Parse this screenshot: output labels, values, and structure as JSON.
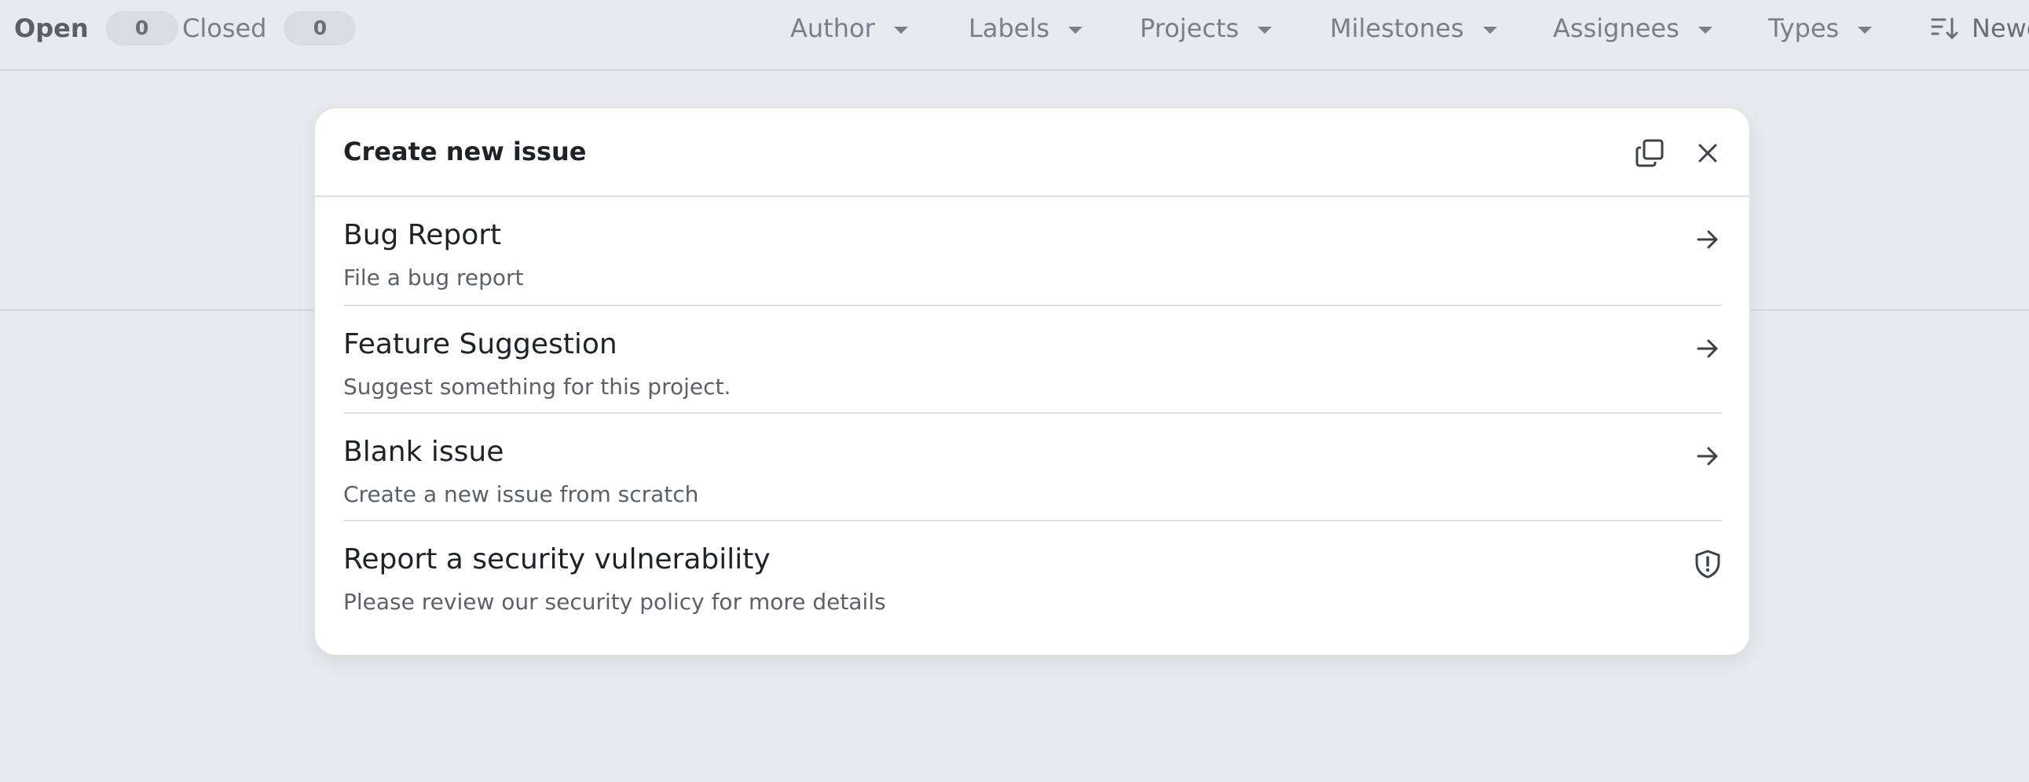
{
  "topbar": {
    "open_label": "Open",
    "open_count": "0",
    "closed_label": "Closed",
    "closed_count": "0",
    "filters": {
      "author": "Author",
      "labels": "Labels",
      "projects": "Projects",
      "milestones": "Milestones",
      "assignees": "Assignees",
      "types": "Types"
    },
    "sort_label": "Newest",
    "sort_icon": "sort-descending-icon"
  },
  "modal": {
    "title": "Create new issue",
    "copy_icon": "copy-icon",
    "close_icon": "close-icon",
    "options": [
      {
        "title": "Bug Report",
        "description": "File a bug report",
        "icon": "arrow-right-icon"
      },
      {
        "title": "Feature Suggestion",
        "description": "Suggest something for this project.",
        "icon": "arrow-right-icon"
      },
      {
        "title": "Blank issue",
        "description": "Create a new issue from scratch",
        "icon": "arrow-right-icon"
      },
      {
        "title": "Report a security vulnerability",
        "description": "Please review our security policy for more details",
        "icon": "shield-alert-icon"
      }
    ]
  },
  "colors": {
    "page_background": "#e8eaee",
    "modal_background": "#ffffff",
    "muted_text": "#7a7f87",
    "primary_text": "#1f2328"
  }
}
